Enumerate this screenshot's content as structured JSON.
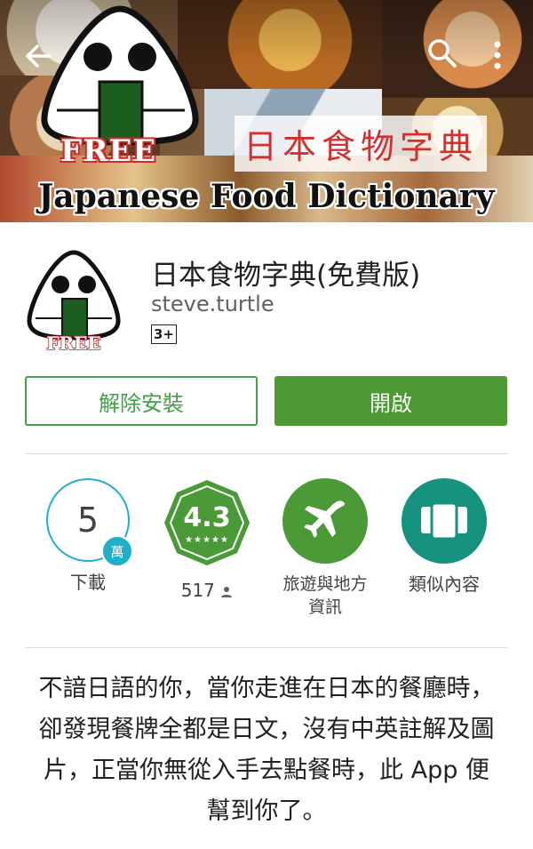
{
  "hero": {
    "free_badge": "FREE",
    "jp_title": "日本食物字典",
    "en_title": "Japanese Food Dictionary"
  },
  "app": {
    "title": "日本食物字典(免費版)",
    "developer": "steve.turtle",
    "content_rating": "3+",
    "icon_badge": "FREE"
  },
  "buttons": {
    "uninstall": "解除安裝",
    "open": "開啟"
  },
  "stats": {
    "downloads": {
      "value": "5",
      "unit": "萬",
      "label": "下載"
    },
    "rating": {
      "value": "4.3",
      "count": "517",
      "count_icon": "person-icon"
    },
    "category": {
      "label": "旅遊與地方資訊",
      "icon": "airplane-icon"
    },
    "similar": {
      "label": "類似內容",
      "icon": "cards-icon"
    }
  },
  "description": "不諳日語的你，當你走進在日本的餐廳時，卻發現餐牌全都是日文，沒有中英註解及圖片，正當你無從入手去點餐時，此 App 便幫到你了。",
  "colors": {
    "primary_green": "#4d9a35",
    "teal": "#16937f",
    "downloads_ring": "#1fb0c7",
    "title_red": "#d32f2f"
  }
}
